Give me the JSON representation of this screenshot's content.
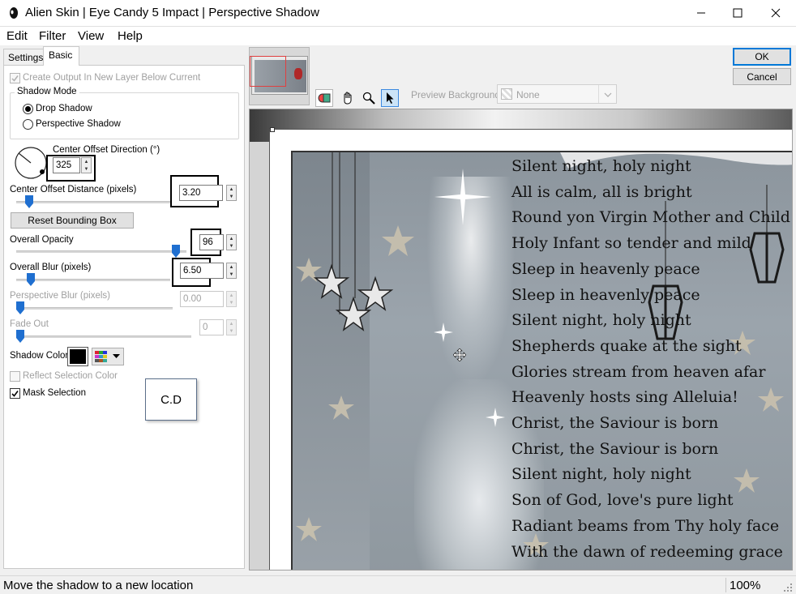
{
  "window": {
    "title": "Alien Skin | Eye Candy 5 Impact | Perspective Shadow"
  },
  "menu": [
    "Edit",
    "Filter",
    "View",
    "Help"
  ],
  "tabs": {
    "settings": "Settings",
    "basic": "Basic"
  },
  "options": {
    "create_output": "Create Output In New Layer Below Current",
    "shadow_mode_label": "Shadow Mode",
    "drop_shadow": "Drop Shadow",
    "perspective_shadow": "Perspective Shadow",
    "center_offset_direction": "Center Offset Direction (°)",
    "center_offset_direction_value": "325",
    "center_offset_distance": "Center Offset Distance (pixels)",
    "center_offset_distance_value": "3.20",
    "reset_bounding_box": "Reset Bounding Box",
    "overall_opacity": "Overall Opacity",
    "overall_opacity_value": "96",
    "overall_blur": "Overall Blur (pixels)",
    "overall_blur_value": "6.50",
    "perspective_blur": "Perspective Blur (pixels)",
    "perspective_blur_value": "0.00",
    "fade_out": "Fade Out",
    "fade_out_value": "0",
    "shadow_color": "Shadow Color",
    "reflect_selection_color": "Reflect Selection Color",
    "mask_selection": "Mask Selection",
    "note_box": "C.D"
  },
  "slider_levels": {
    "center_offset_distance": 0.06,
    "overall_opacity": 0.96,
    "overall_blur": 0.07,
    "perspective_blur": 0.0,
    "fade_out": 0.0
  },
  "actions": {
    "ok": "OK",
    "cancel": "Cancel"
  },
  "preview_bg": {
    "label": "Preview Background:",
    "value": "None"
  },
  "poem_lines": [
    "Silent night, holy night",
    "All is calm, all is bright",
    "Round yon Virgin Mother and Child",
    "Holy Infant so tender and mild",
    "Sleep in heavenly peace",
    "Sleep in heavenly peace",
    "Silent night, holy night",
    "Shepherds quake at the sight",
    "Glories stream from heaven afar",
    "Heavenly hosts sing Alleluia!",
    "Christ, the Saviour is born",
    "Christ, the Saviour is born",
    "Silent night, holy night",
    "Son of God, love's pure light",
    "Radiant beams from Thy holy face",
    "With the dawn of redeeming grace"
  ],
  "status": {
    "message": "Move the shadow to a new location",
    "zoom": "100%"
  },
  "colors": {
    "accent": "#1f6fd0",
    "shadow_color": "#000000",
    "preview_bg": "#8e99a3"
  }
}
